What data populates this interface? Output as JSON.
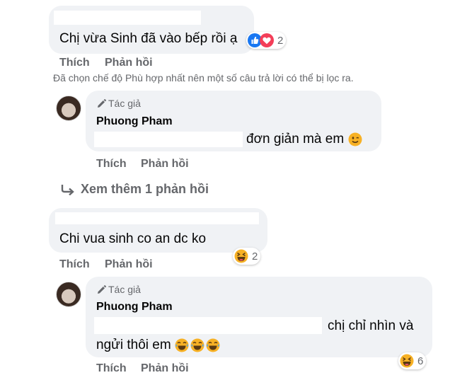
{
  "comments": [
    {
      "text": "Chị vừa Sinh đã vào bếp rồi ạ",
      "reactions": {
        "icons": [
          "like-icon",
          "love-icon"
        ],
        "count": "2"
      },
      "actions": {
        "like": "Thích",
        "reply": "Phản hồi"
      }
    },
    {
      "text": "Chi vua sinh co an dc ko",
      "reactions": {
        "icons": [
          "laugh-emoji-icon"
        ],
        "count": "2"
      },
      "actions": {
        "like": "Thích",
        "reply": "Phản hồi"
      }
    }
  ],
  "filter_notice": "Đã chọn chế độ Phù hợp nhất nên một số câu trả lời có thể bị lọc ra.",
  "replies": [
    {
      "author_badge": "Tác giả",
      "author_name": "Phuong Pham",
      "text": "đơn giản mà em",
      "emoji": "wink-emoji-icon",
      "actions": {
        "like": "Thích",
        "reply": "Phản hồi"
      }
    },
    {
      "author_badge": "Tác giả",
      "author_name": "Phuong Pham",
      "text_line1": "chị chỉ nhìn và",
      "text_line2": "ngửi thôi em",
      "emoji": [
        "laugh-emoji-icon",
        "laugh-emoji-icon",
        "laugh-emoji-icon"
      ],
      "reactions": {
        "icons": [
          "laugh-emoji-icon"
        ],
        "count": "6"
      },
      "actions": {
        "like": "Thích",
        "reply": "Phản hồi"
      }
    }
  ],
  "view_more": {
    "icon": "reply-arrow-icon",
    "label": "Xem thêm 1 phản hồi"
  },
  "colors": {
    "bubble": "#f0f2f5",
    "secondary_text": "#65676b",
    "like_blue": "#1877f2",
    "love_red": "#f33e58",
    "emoji_yellow": "#f7b125"
  }
}
